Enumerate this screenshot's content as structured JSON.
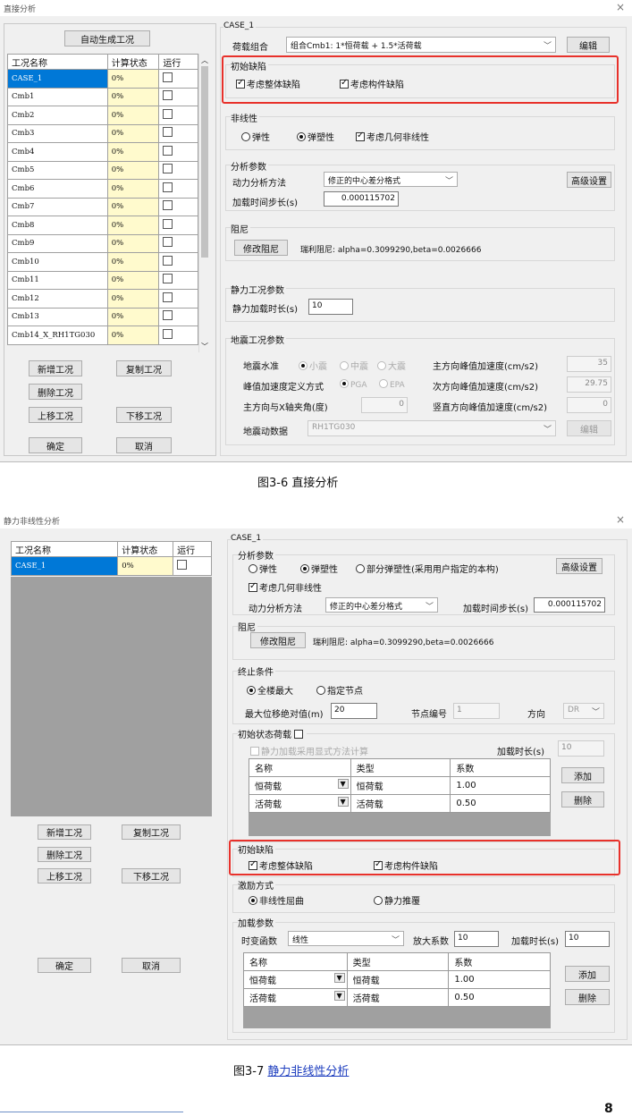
{
  "win1": {
    "title": "直接分析",
    "close": "×",
    "auto_btn": "自动生成工况",
    "table": {
      "headers": [
        "工况名称",
        "计算状态",
        "运行"
      ],
      "rows": [
        {
          "name": "CASE_1",
          "status": "0%"
        },
        {
          "name": "Cmb1",
          "status": "0%"
        },
        {
          "name": "Cmb2",
          "status": "0%"
        },
        {
          "name": "Cmb3",
          "status": "0%"
        },
        {
          "name": "Cmb4",
          "status": "0%"
        },
        {
          "name": "Cmb5",
          "status": "0%"
        },
        {
          "name": "Cmb6",
          "status": "0%"
        },
        {
          "name": "Cmb7",
          "status": "0%"
        },
        {
          "name": "Cmb8",
          "status": "0%"
        },
        {
          "name": "Cmb9",
          "status": "0%"
        },
        {
          "name": "Cmb10",
          "status": "0%"
        },
        {
          "name": "Cmb11",
          "status": "0%"
        },
        {
          "name": "Cmb12",
          "status": "0%"
        },
        {
          "name": "Cmb13",
          "status": "0%"
        },
        {
          "name": "Cmb14_X_RH1TG030",
          "status": "0%"
        }
      ]
    },
    "buttons": {
      "add": "新增工况",
      "copy": "复制工况",
      "delete": "删除工况",
      "up": "上移工况",
      "down": "下移工况",
      "ok": "确定",
      "cancel": "取消"
    },
    "case_label": "CASE_1",
    "load_combo_label": "荷载组合",
    "load_combo_value": "组合Cmb1: 1*恒荷载 + 1.5*活荷载",
    "edit_btn": "编辑",
    "initial_defect": {
      "title": "初始缺陷",
      "global": "考虑整体缺陷",
      "member": "考虑构件缺陷"
    },
    "nonlinear": {
      "title": "非线性",
      "elastic": "弹性",
      "elastoplastic": "弹塑性",
      "geometric": "考虑几何非线性"
    },
    "analysis": {
      "title": "分析参数",
      "method_label": "动力分析方法",
      "method_value": "修正的中心差分格式",
      "step_label": "加载时间步长(s)",
      "step_value": "0.000115702",
      "advanced": "高级设置"
    },
    "damping": {
      "title": "阻尼",
      "btn": "修改阻尼",
      "text": "瑞利阻尼: alpha=0.3099290,beta=0.0026666"
    },
    "static": {
      "title": "静力工况参数",
      "label": "静力加载时长(s)",
      "value": "10"
    },
    "seismic": {
      "title": "地震工况参数",
      "level_label": "地震水准",
      "levels": [
        "小震",
        "中震",
        "大震"
      ],
      "peak_def_label": "峰值加速度定义方式",
      "peak_opts": [
        "PGA",
        "EPA"
      ],
      "angle_label": "主方向与X轴夹角(度)",
      "angle_value": "0",
      "data_label": "地震动数据",
      "data_value": "RH1TG030",
      "main_acc_label": "主方向峰值加速度(cm/s2)",
      "main_acc_value": "35",
      "sec_acc_label": "次方向峰值加速度(cm/s2)",
      "sec_acc_value": "29.75",
      "vert_acc_label": "竖直方向峰值加速度(cm/s2)",
      "vert_acc_value": "0",
      "edit_btn": "编辑"
    }
  },
  "caption1": "图3-6  直接分析",
  "win2": {
    "title": "静力非线性分析",
    "close": "×",
    "table": {
      "headers": [
        "工况名称",
        "计算状态",
        "运行"
      ],
      "rows": [
        {
          "name": "CASE_1",
          "status": "0%"
        }
      ]
    },
    "buttons": {
      "add": "新增工况",
      "copy": "复制工况",
      "delete": "删除工况",
      "up": "上移工况",
      "down": "下移工况",
      "ok": "确定",
      "cancel": "取消"
    },
    "case_label": "CASE_1",
    "analysis": {
      "title": "分析参数",
      "elastic": "弹性",
      "elastoplastic": "弹塑性",
      "partial": "部分弹塑性(采用用户指定的本构)",
      "advanced": "高级设置",
      "geometric": "考虑几何非线性",
      "method_label": "动力分析方法",
      "method_value": "修正的中心差分格式",
      "step_label": "加载时间步长(s)",
      "step_value": "0.000115702"
    },
    "damping": {
      "title": "阻尼",
      "btn": "修改阻尼",
      "text": "瑞利阻尼: alpha=0.3099290,beta=0.0026666"
    },
    "termination": {
      "title": "终止条件",
      "all_max": "全楼最大",
      "node": "指定节点",
      "max_disp_label": "最大位移绝对值(m)",
      "max_disp_value": "20",
      "node_label": "节点编号",
      "node_value": "1",
      "dir_label": "方向",
      "dir_value": "DR"
    },
    "initial_load": {
      "title": "初始状态荷载",
      "explicit": "静力加载采用显式方法计算",
      "time_label": "加载时长(s)",
      "time_value": "10",
      "headers": [
        "名称",
        "类型",
        "系数"
      ],
      "rows": [
        {
          "name": "恒荷载",
          "type": "恒荷载",
          "coef": "1.00"
        },
        {
          "name": "活荷载",
          "type": "活荷载",
          "coef": "0.50"
        }
      ],
      "add": "添加",
      "del": "删除"
    },
    "initial_defect": {
      "title": "初始缺陷",
      "global": "考虑整体缺陷",
      "member": "考虑构件缺陷"
    },
    "excitation": {
      "title": "激励方式",
      "buckling": "非线性屈曲",
      "pushover": "静力推覆"
    },
    "loading": {
      "title": "加载参数",
      "func_label": "时变函数",
      "func_value": "线性",
      "amp_label": "放大系数",
      "amp_value": "10",
      "time_label": "加载时长(s)",
      "time_value": "10",
      "headers": [
        "名称",
        "类型",
        "系数"
      ],
      "rows": [
        {
          "name": "恒荷载",
          "type": "恒荷载",
          "coef": "1.00"
        },
        {
          "name": "活荷载",
          "type": "活荷载",
          "coef": "0.50"
        }
      ],
      "add": "添加",
      "del": "删除"
    }
  },
  "caption2_prefix": "图3-7  ",
  "caption2_link": "静力非线性分析",
  "page_number": "8",
  "colors": {
    "selection": "#0078d7",
    "highlight": "#e8312b",
    "status_bg": "#fffacd"
  }
}
